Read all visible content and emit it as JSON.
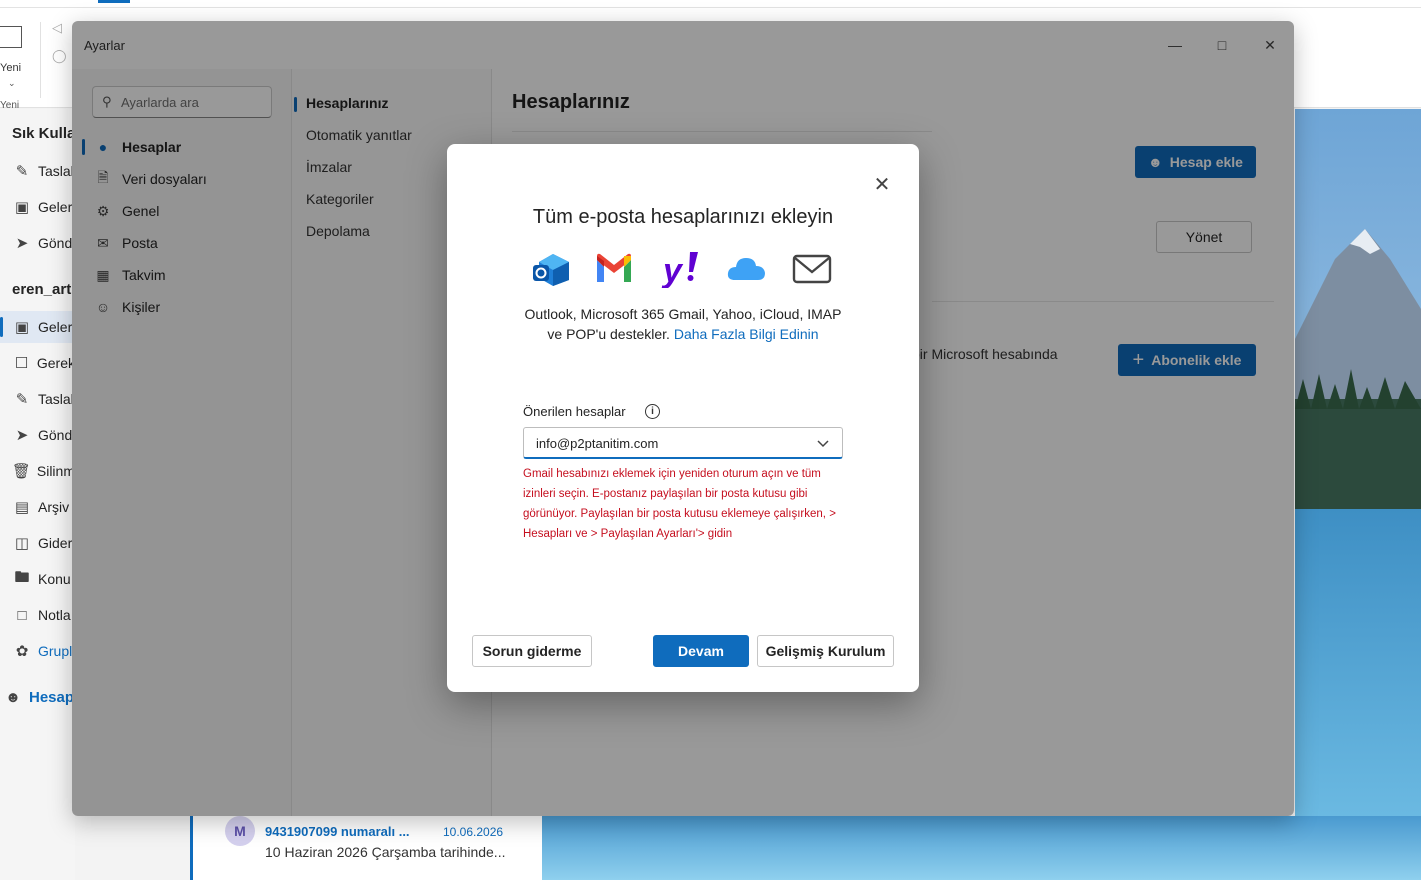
{
  "app": {
    "ribbon": {
      "new_label": "Yeni",
      "new_group_label": "Yeni"
    },
    "nav": {
      "favorites_header": "Sık Kulla",
      "favorites": [
        {
          "label": "Taslal",
          "icon": "draft-icon"
        },
        {
          "label": "Geler",
          "icon": "inbox-icon"
        },
        {
          "label": "Gönd",
          "icon": "send-icon"
        }
      ],
      "account_header": "eren_art",
      "folders": [
        {
          "label": "Geler",
          "icon": "inbox-icon"
        },
        {
          "label": "Gerek",
          "icon": "junk-icon"
        },
        {
          "label": "Taslal",
          "icon": "draft-icon"
        },
        {
          "label": "Gönd",
          "icon": "send-icon"
        },
        {
          "label": "Silinm",
          "icon": "trash-icon"
        },
        {
          "label": "Arşiv",
          "icon": "archive-icon"
        },
        {
          "label": "Gider",
          "icon": "outbox-icon"
        },
        {
          "label": "Konu:",
          "icon": "folder-icon"
        },
        {
          "label": "Notla",
          "icon": "note-icon"
        },
        {
          "label": "Grupl",
          "icon": "groups-icon"
        }
      ],
      "add_account": "Hesap"
    },
    "message": {
      "avatar_initial": "M",
      "subject": "9431907099 numaralı ...",
      "date": "10.06.2026",
      "preview": "10 Haziran 2026 Çarşamba tarihinde..."
    }
  },
  "settings": {
    "window_title": "Ayarlar",
    "search_placeholder": "Ayarlarda ara",
    "categories": [
      {
        "label": "Hesaplar",
        "icon": "person-icon",
        "selected": true
      },
      {
        "label": "Veri dosyaları",
        "icon": "data-file-icon",
        "selected": false
      },
      {
        "label": "Genel",
        "icon": "gear-icon",
        "selected": false
      },
      {
        "label": "Posta",
        "icon": "mail-icon",
        "selected": false
      },
      {
        "label": "Takvim",
        "icon": "calendar-icon",
        "selected": false
      },
      {
        "label": "Kişiler",
        "icon": "people-icon",
        "selected": false
      }
    ],
    "subcategories": [
      {
        "label": "Hesaplarınız",
        "selected": true
      },
      {
        "label": "Otomatik yanıtlar",
        "selected": false
      },
      {
        "label": "İmzalar",
        "selected": false
      },
      {
        "label": "Kategoriler",
        "selected": false
      },
      {
        "label": "Depolama",
        "selected": false
      }
    ],
    "page_title": "Hesaplarınız",
    "add_account_btn": "Hesap ekle",
    "manage_btn": "Yönet",
    "subscription_text": "bir Microsoft hesabında",
    "add_subscription_btn": "Abonelik ekle"
  },
  "dialog": {
    "title": "Tüm e-posta hesaplarınızı ekleyin",
    "providers": [
      "outlook-icon",
      "gmail-icon",
      "yahoo-icon",
      "icloud-icon",
      "generic-mail-icon"
    ],
    "description": "Outlook, Microsoft 365 Gmail, Yahoo, iCloud, IMAP ve POP'u destekler.",
    "learn_more": "Daha Fazla Bilgi Edinin",
    "suggested_label": "Önerilen hesaplar",
    "selected_account": "info@p2ptanitim.com",
    "error_text": "Gmail hesabınızı eklemek için yeniden oturum açın ve tüm izinleri seçin. E-postanız paylaşılan bir posta kutusu gibi görünüyor. Paylaşılan bir posta kutusu eklemeye çalışırken, > Hesapları ve > Paylaşılan Ayarları'> gidin",
    "troubleshoot_btn": "Sorun giderme",
    "continue_btn": "Devam",
    "advanced_btn": "Gelişmiş Kurulum"
  },
  "colors": {
    "accent": "#0f6cbd",
    "error": "#c50f1f"
  }
}
